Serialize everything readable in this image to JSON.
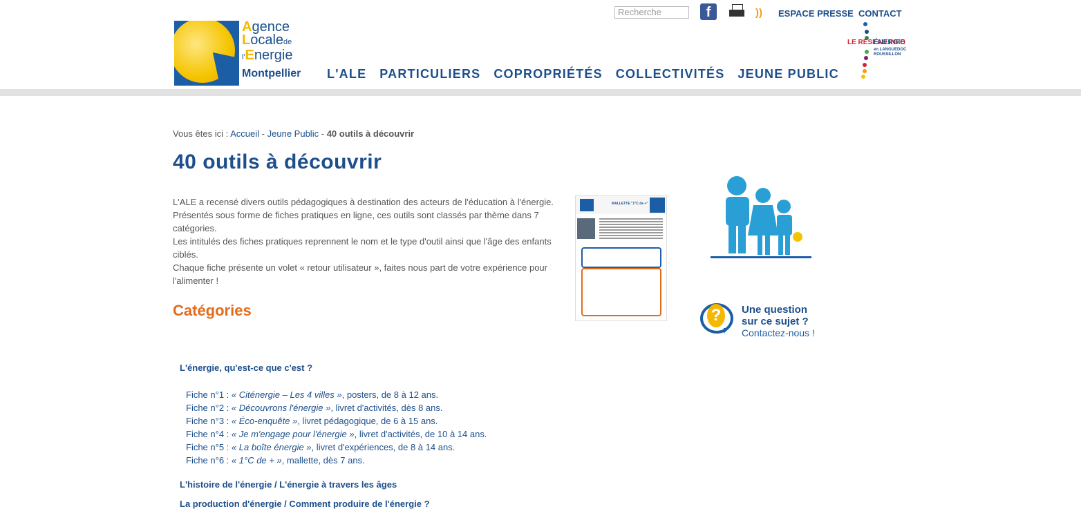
{
  "header": {
    "logo": {
      "line1_initial": "A",
      "line1_rest": "gence",
      "line2_initial": "L",
      "line2_rest": "ocale",
      "line2_suffix": "de",
      "line3_prefix": "l'",
      "line3_initial": "E",
      "line3_rest": "nergie",
      "city": "Montpellier"
    },
    "search_placeholder": "Recherche",
    "fb_label": "f",
    "rss_label": "))",
    "links": [
      "ESPACE PRESSE",
      "CONTACT"
    ],
    "nav": [
      "L'ALE",
      "PARTICULIERS",
      "COPROPRIÉTÉS",
      "COLLECTIVITÉS",
      "JEUNE PUBLIC"
    ],
    "info_logo": {
      "t1": "LE RÉSEAU INFO",
      "t2": "ÉNERGIE",
      "t3a": "en LANGUEDOC",
      "t3b": "ROUSSILLON"
    }
  },
  "breadcrumb": {
    "prefix": "Vous êtes ici :",
    "home": "Accueil",
    "sep": "-",
    "section": "Jeune Public",
    "current": "40 outils à découvrir"
  },
  "page_title": "40 outils à découvrir",
  "intro": [
    "L'ALE a recensé divers outils pédagogiques à destination des acteurs de l'éducation à l'énergie.",
    "Présentés sous forme de fiches pratiques en ligne, ces outils sont classés par thème dans 7 catégories.",
    "Les intitulés des fiches pratiques reprennent le nom et le type d'outil ainsi que l'âge des enfants ciblés.",
    "Chaque fiche présente un volet « retour utilisateur », faites nous part de votre expérience pour l'alimenter !"
  ],
  "categories_title": "Catégories",
  "categories": [
    "L'énergie, qu'est-ce que c'est ?",
    "L'histoire de l'énergie / L'énergie à travers les âges",
    "La production d'énergie / Comment produire de l'énergie ?"
  ],
  "fiches": [
    {
      "num": "Fiche n°1 :",
      "title": "« Citénergie – Les 4 villes »",
      "desc": ", posters, de 8 à 12 ans."
    },
    {
      "num": "Fiche n°2 :",
      "title": "« Découvrons l'énergie »",
      "desc": ", livret d'activités, dès 8 ans."
    },
    {
      "num": "Fiche n°3 :",
      "title": "« Éco-enquête »",
      "desc": ", livret pédagogique, de 6 à 15 ans."
    },
    {
      "num": "Fiche n°4 :",
      "title": "« Je m'engage pour l'énergie »",
      "desc": ", livret d'activités, de 10 à 14 ans."
    },
    {
      "num": "Fiche n°5 :",
      "title": "« La boîte énergie »",
      "desc": ", livret d'expériences, de 8 à 14 ans."
    },
    {
      "num": "Fiche n°6 :",
      "title": "« 1°C de + »",
      "desc": ", mallette, dès 7 ans."
    }
  ],
  "doc_thumbnail": {
    "title": "MALLETTE \"1°C de +\""
  },
  "contact_box": {
    "line1": "Une question",
    "line2": "sur ce sujet ?",
    "line3": "Contactez-nous !",
    "q": "?"
  },
  "colors": {
    "brand_blue": "#1d4f8c",
    "accent_orange": "#e36c1a",
    "sun_yellow": "#f5c400"
  }
}
